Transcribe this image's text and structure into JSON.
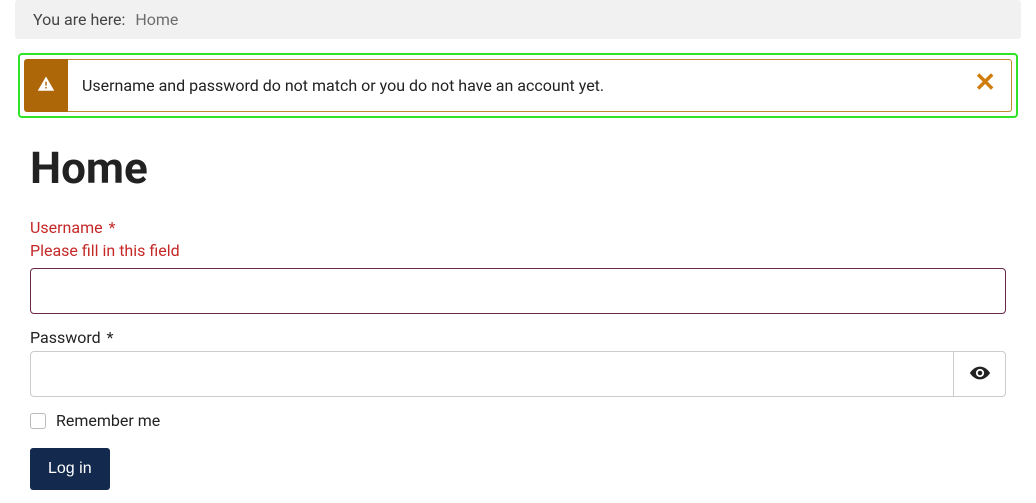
{
  "breadcrumb": {
    "prefix": "You are here:",
    "current": "Home"
  },
  "alert": {
    "message": "Username and password do not match or you do not have an account yet."
  },
  "page": {
    "title": "Home"
  },
  "form": {
    "username": {
      "label": "Username",
      "required_mark": "*",
      "help": "Please fill in this field",
      "value": ""
    },
    "password": {
      "label": "Password",
      "required_mark": "*",
      "value": ""
    },
    "remember": {
      "label": "Remember me"
    },
    "submit": {
      "label": "Log in"
    }
  }
}
